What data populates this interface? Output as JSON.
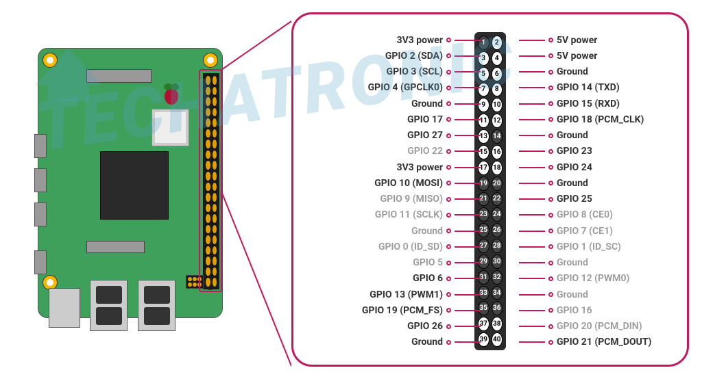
{
  "watermark_text": "TECHATRONIC",
  "pins": [
    {
      "left": "3V3 power",
      "right": "5V power",
      "lf": false,
      "rf": false,
      "ls": true,
      "rs": false
    },
    {
      "left": "GPIO 2 (SDA)",
      "right": "5V power",
      "lf": false,
      "rf": false,
      "ls": false,
      "rs": false
    },
    {
      "left": "GPIO 3 (SCL)",
      "right": "Ground",
      "lf": false,
      "rf": false,
      "ls": false,
      "rs": false
    },
    {
      "left": "GPIO 4 (GPCLK0)",
      "right": "GPIO 14 (TXD)",
      "lf": false,
      "rf": false,
      "ls": false,
      "rs": false
    },
    {
      "left": "Ground",
      "right": "GPIO 15 (RXD)",
      "lf": false,
      "rf": false,
      "ls": false,
      "rs": false
    },
    {
      "left": "GPIO 17",
      "right": "GPIO 18 (PCM_CLK)",
      "lf": false,
      "rf": false,
      "ls": false,
      "rs": false
    },
    {
      "left": "GPIO 27",
      "right": "Ground",
      "lf": false,
      "rf": false,
      "ls": false,
      "rs": true
    },
    {
      "left": "GPIO 22",
      "right": "GPIO 23",
      "lf": true,
      "rf": false,
      "ls": false,
      "rs": false
    },
    {
      "left": "3V3 power",
      "right": "GPIO 24",
      "lf": false,
      "rf": false,
      "ls": false,
      "rs": false
    },
    {
      "left": "GPIO 10 (MOSI)",
      "right": "Ground",
      "lf": false,
      "rf": false,
      "ls": true,
      "rs": true
    },
    {
      "left": "GPIO 9 (MISO)",
      "right": "GPIO 25",
      "lf": true,
      "rf": false,
      "ls": true,
      "rs": true
    },
    {
      "left": "GPIO 11 (SCLK)",
      "right": "GPIO 8 (CE0)",
      "lf": true,
      "rf": true,
      "ls": true,
      "rs": true
    },
    {
      "left": "Ground",
      "right": "GPIO 7 (CE1)",
      "lf": true,
      "rf": true,
      "ls": true,
      "rs": true
    },
    {
      "left": "GPIO 0 (ID_SD)",
      "right": "GPIO 1 (ID_SC)",
      "lf": true,
      "rf": true,
      "ls": true,
      "rs": true
    },
    {
      "left": "GPIO 5",
      "right": "Ground",
      "lf": true,
      "rf": true,
      "ls": true,
      "rs": true
    },
    {
      "left": "GPIO 6",
      "right": "GPIO 12 (PWM0)",
      "lf": false,
      "rf": true,
      "ls": true,
      "rs": true
    },
    {
      "left": "GPIO 13 (PWM1)",
      "right": "Ground",
      "lf": false,
      "rf": true,
      "ls": true,
      "rs": true
    },
    {
      "left": "GPIO 19 (PCM_FS)",
      "right": "GPIO 16",
      "lf": false,
      "rf": true,
      "ls": true,
      "rs": true
    },
    {
      "left": "GPIO 26",
      "right": "GPIO 20 (PCM_DIN)",
      "lf": false,
      "rf": true,
      "ls": false,
      "rs": false
    },
    {
      "left": "Ground",
      "right": "GPIO 21 (PCM_DOUT)",
      "lf": false,
      "rf": false,
      "ls": false,
      "rs": false
    }
  ]
}
